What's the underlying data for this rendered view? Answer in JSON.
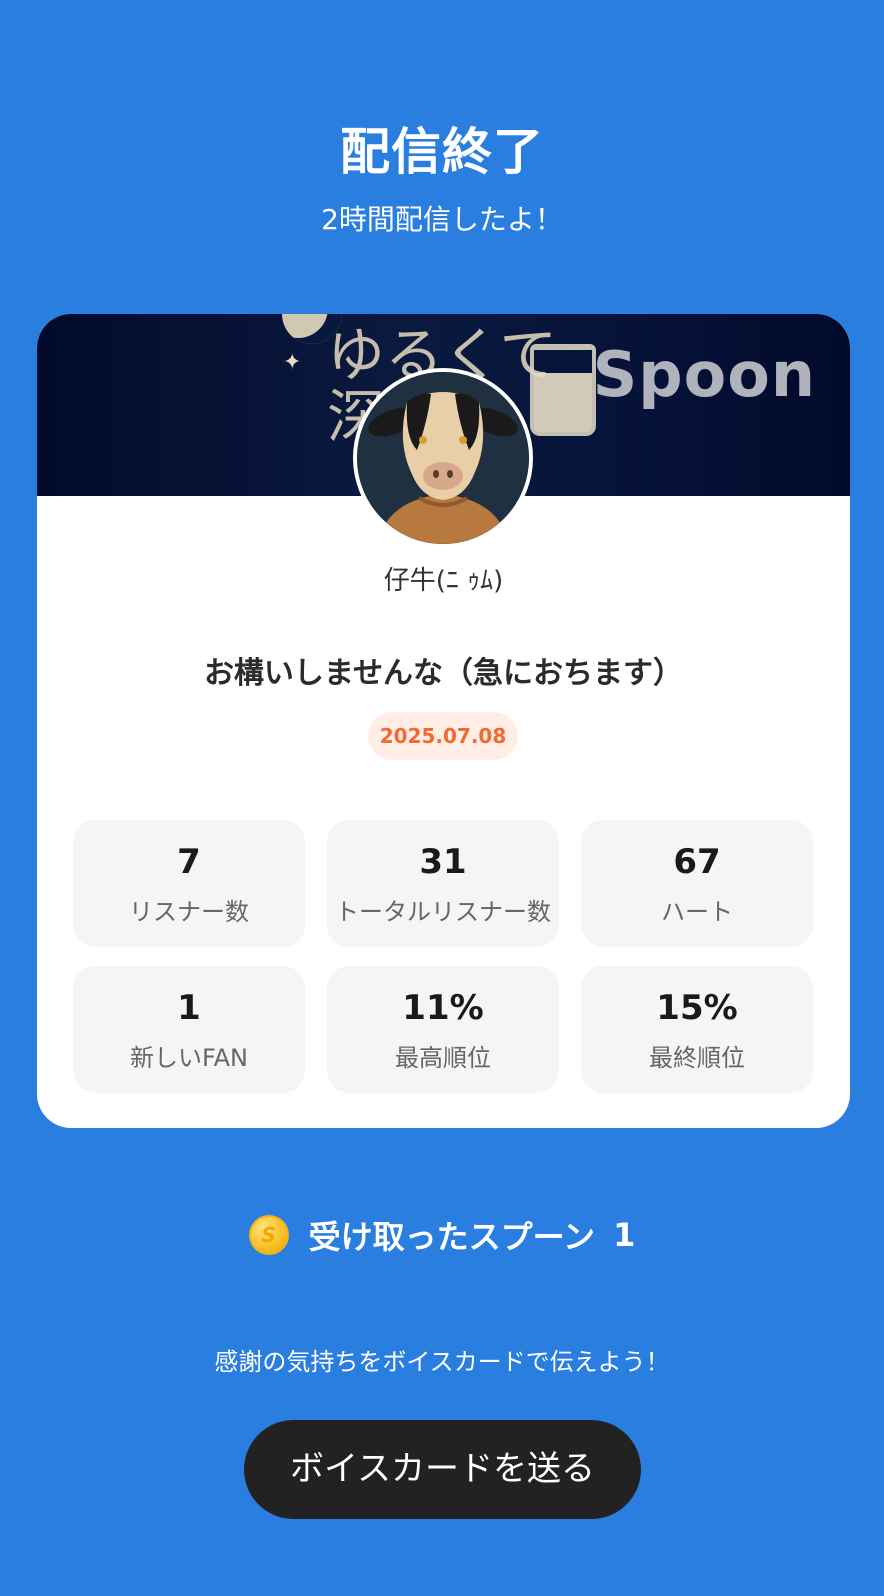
{
  "header": {
    "title": "配信終了",
    "subtitle": "2時間配信したよ！"
  },
  "card": {
    "banner": {
      "text_line1": "ゆるくて",
      "text_line2": "深",
      "brand": "Spoon"
    },
    "username": "仔牛(ﾆ ｩﾑ)",
    "stream_title": "お構いしませんな（急におちます）",
    "date": "2025.07.08",
    "stats": [
      {
        "value": "7",
        "label": "リスナー数"
      },
      {
        "value": "31",
        "label": "トータルリスナー数"
      },
      {
        "value": "67",
        "label": "ハート"
      },
      {
        "value": "1",
        "label": "新しいFAN"
      },
      {
        "value": "11%",
        "label": "最高順位"
      },
      {
        "value": "15%",
        "label": "最終順位"
      }
    ]
  },
  "spoons": {
    "coin_symbol": "S",
    "label": "受け取ったスプーン",
    "count": "1"
  },
  "thanks_text": "感謝の気持ちをボイスカードで伝えよう！",
  "send_button_label": "ボイスカードを送る",
  "colors": {
    "background": "#2A7EE0",
    "date_badge_text": "#F06A33",
    "date_badge_bg": "#FFEDE6",
    "button_bg": "#222222"
  }
}
